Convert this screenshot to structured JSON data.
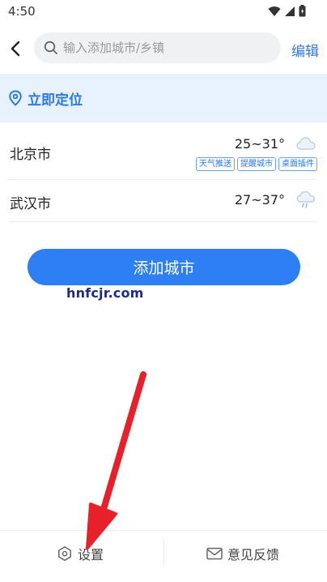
{
  "status_bar": {
    "time": "4:50"
  },
  "header": {
    "search_placeholder": "输入添加城市/乡镇",
    "edit_label": "编辑"
  },
  "locate": {
    "label": "立即定位"
  },
  "cities": [
    {
      "name": "北京市",
      "temp": "25~31°",
      "icon": "cloudy-icon",
      "tags": [
        "天气推送",
        "提醒城市",
        "桌面插件"
      ]
    },
    {
      "name": "武汉市",
      "temp": "27~37°",
      "icon": "rain-shower-icon",
      "tags": []
    }
  ],
  "add_city_label": "添加城市",
  "watermark": "hnfcjr.com",
  "bottom_bar": {
    "settings_label": "设置",
    "feedback_label": "意见反馈"
  },
  "colors": {
    "accent": "#2a78f2",
    "locate_bg": "#e8f2fd",
    "annotation_arrow": "#e8202a"
  }
}
